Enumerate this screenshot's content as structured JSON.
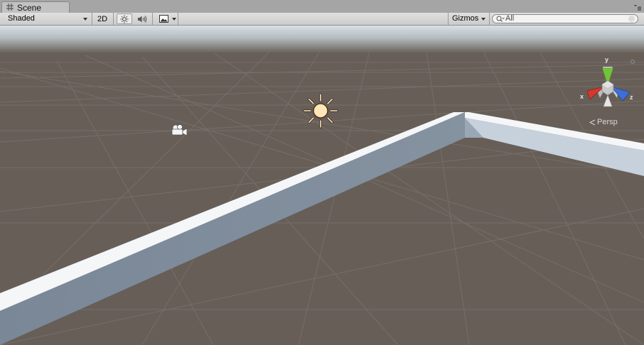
{
  "tab": {
    "title": "Scene"
  },
  "toolbar": {
    "render_mode": "Shaded",
    "mode_2d": "2D",
    "gizmos_label": "Gizmos",
    "search_placeholder": "All"
  },
  "viewport": {
    "projection_label": "Persp",
    "axis_labels": {
      "x": "x",
      "y": "y",
      "z": "z"
    },
    "colors": {
      "ground": "#675e58",
      "sky": "#cdd7de",
      "wall_top": "#f4f6f8",
      "wall_side": "#7e8b9a",
      "axis_x": "#d5392d",
      "axis_y": "#72c23a",
      "axis_z": "#3e6fd6"
    },
    "icons": [
      "directional-light-sun-icon",
      "camera-gizmo-icon",
      "scene-orientation-gizmo"
    ]
  }
}
